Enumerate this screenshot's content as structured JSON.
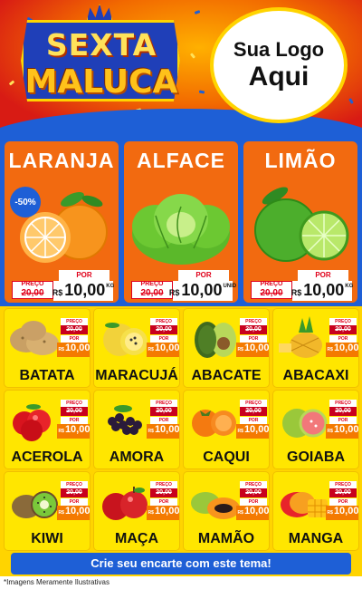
{
  "header": {
    "badge_top": "SEXTA",
    "badge_bottom": "MALUCA",
    "logo_line1": "Sua Logo",
    "logo_line2": "Aqui"
  },
  "featured": [
    {
      "name": "LARANJA",
      "discount": "-50%",
      "preco_label": "PREÇO",
      "old_price": "20,00",
      "por_label": "POR",
      "currency": "R$",
      "new_price": "10,00",
      "unit": "KG",
      "icon": "orange-icon"
    },
    {
      "name": "ALFACE",
      "preco_label": "PREÇO",
      "old_price": "20,00",
      "por_label": "POR",
      "currency": "R$",
      "new_price": "10,00",
      "unit": "UNID",
      "icon": "lettuce-icon"
    },
    {
      "name": "LIMÃO",
      "preco_label": "PREÇO",
      "old_price": "20,00",
      "por_label": "POR",
      "currency": "R$",
      "new_price": "10,00",
      "unit": "KG",
      "icon": "lime-icon"
    }
  ],
  "grid": [
    {
      "name": "BATATA",
      "preco_label": "PREÇO",
      "old_price": "20,00",
      "por_label": "POR",
      "currency": "R$",
      "new_price": "10,00",
      "icon": "potato-icon"
    },
    {
      "name": "MARACUJÁ",
      "preco_label": "PREÇO",
      "old_price": "20,00",
      "por_label": "POR",
      "currency": "R$",
      "new_price": "10,00",
      "icon": "passion-fruit-icon"
    },
    {
      "name": "ABACATE",
      "preco_label": "PREÇO",
      "old_price": "20,00",
      "por_label": "POR",
      "currency": "R$",
      "new_price": "10,00",
      "icon": "avocado-icon"
    },
    {
      "name": "ABACAXI",
      "preco_label": "PREÇO",
      "old_price": "20,00",
      "por_label": "POR",
      "currency": "R$",
      "new_price": "10,00",
      "icon": "pineapple-icon"
    },
    {
      "name": "ACEROLA",
      "preco_label": "PREÇO",
      "old_price": "20,00",
      "por_label": "POR",
      "currency": "R$",
      "new_price": "10,00",
      "icon": "acerola-icon"
    },
    {
      "name": "AMORA",
      "preco_label": "PREÇO",
      "old_price": "20,00",
      "por_label": "POR",
      "currency": "R$",
      "new_price": "10,00",
      "icon": "blackberry-icon"
    },
    {
      "name": "CAQUI",
      "preco_label": "PREÇO",
      "old_price": "20,00",
      "por_label": "POR",
      "currency": "R$",
      "new_price": "10,00",
      "icon": "persimmon-icon"
    },
    {
      "name": "GOIABA",
      "preco_label": "PREÇO",
      "old_price": "20,00",
      "por_label": "POR",
      "currency": "R$",
      "new_price": "10,00",
      "icon": "guava-icon"
    },
    {
      "name": "KIWI",
      "preco_label": "PREÇO",
      "old_price": "20,00",
      "por_label": "POR",
      "currency": "R$",
      "new_price": "10,00",
      "icon": "kiwi-icon"
    },
    {
      "name": "MAÇA",
      "preco_label": "PREÇO",
      "old_price": "20,00",
      "por_label": "POR",
      "currency": "R$",
      "new_price": "10,00",
      "icon": "apple-icon"
    },
    {
      "name": "MAMÃO",
      "preco_label": "PREÇO",
      "old_price": "20,00",
      "por_label": "POR",
      "currency": "R$",
      "new_price": "10,00",
      "icon": "papaya-icon"
    },
    {
      "name": "MANGA",
      "preco_label": "PREÇO",
      "old_price": "20,00",
      "por_label": "POR",
      "currency": "R$",
      "new_price": "10,00",
      "icon": "mango-icon"
    }
  ],
  "cta": "Crie seu encarte com este tema!",
  "footer": "*Imagens Meramente Ilustrativas",
  "colors": {
    "blue": "#1e5fd6",
    "orange": "#f26a10",
    "yellow": "#ffd400",
    "red": "#e0001a"
  }
}
